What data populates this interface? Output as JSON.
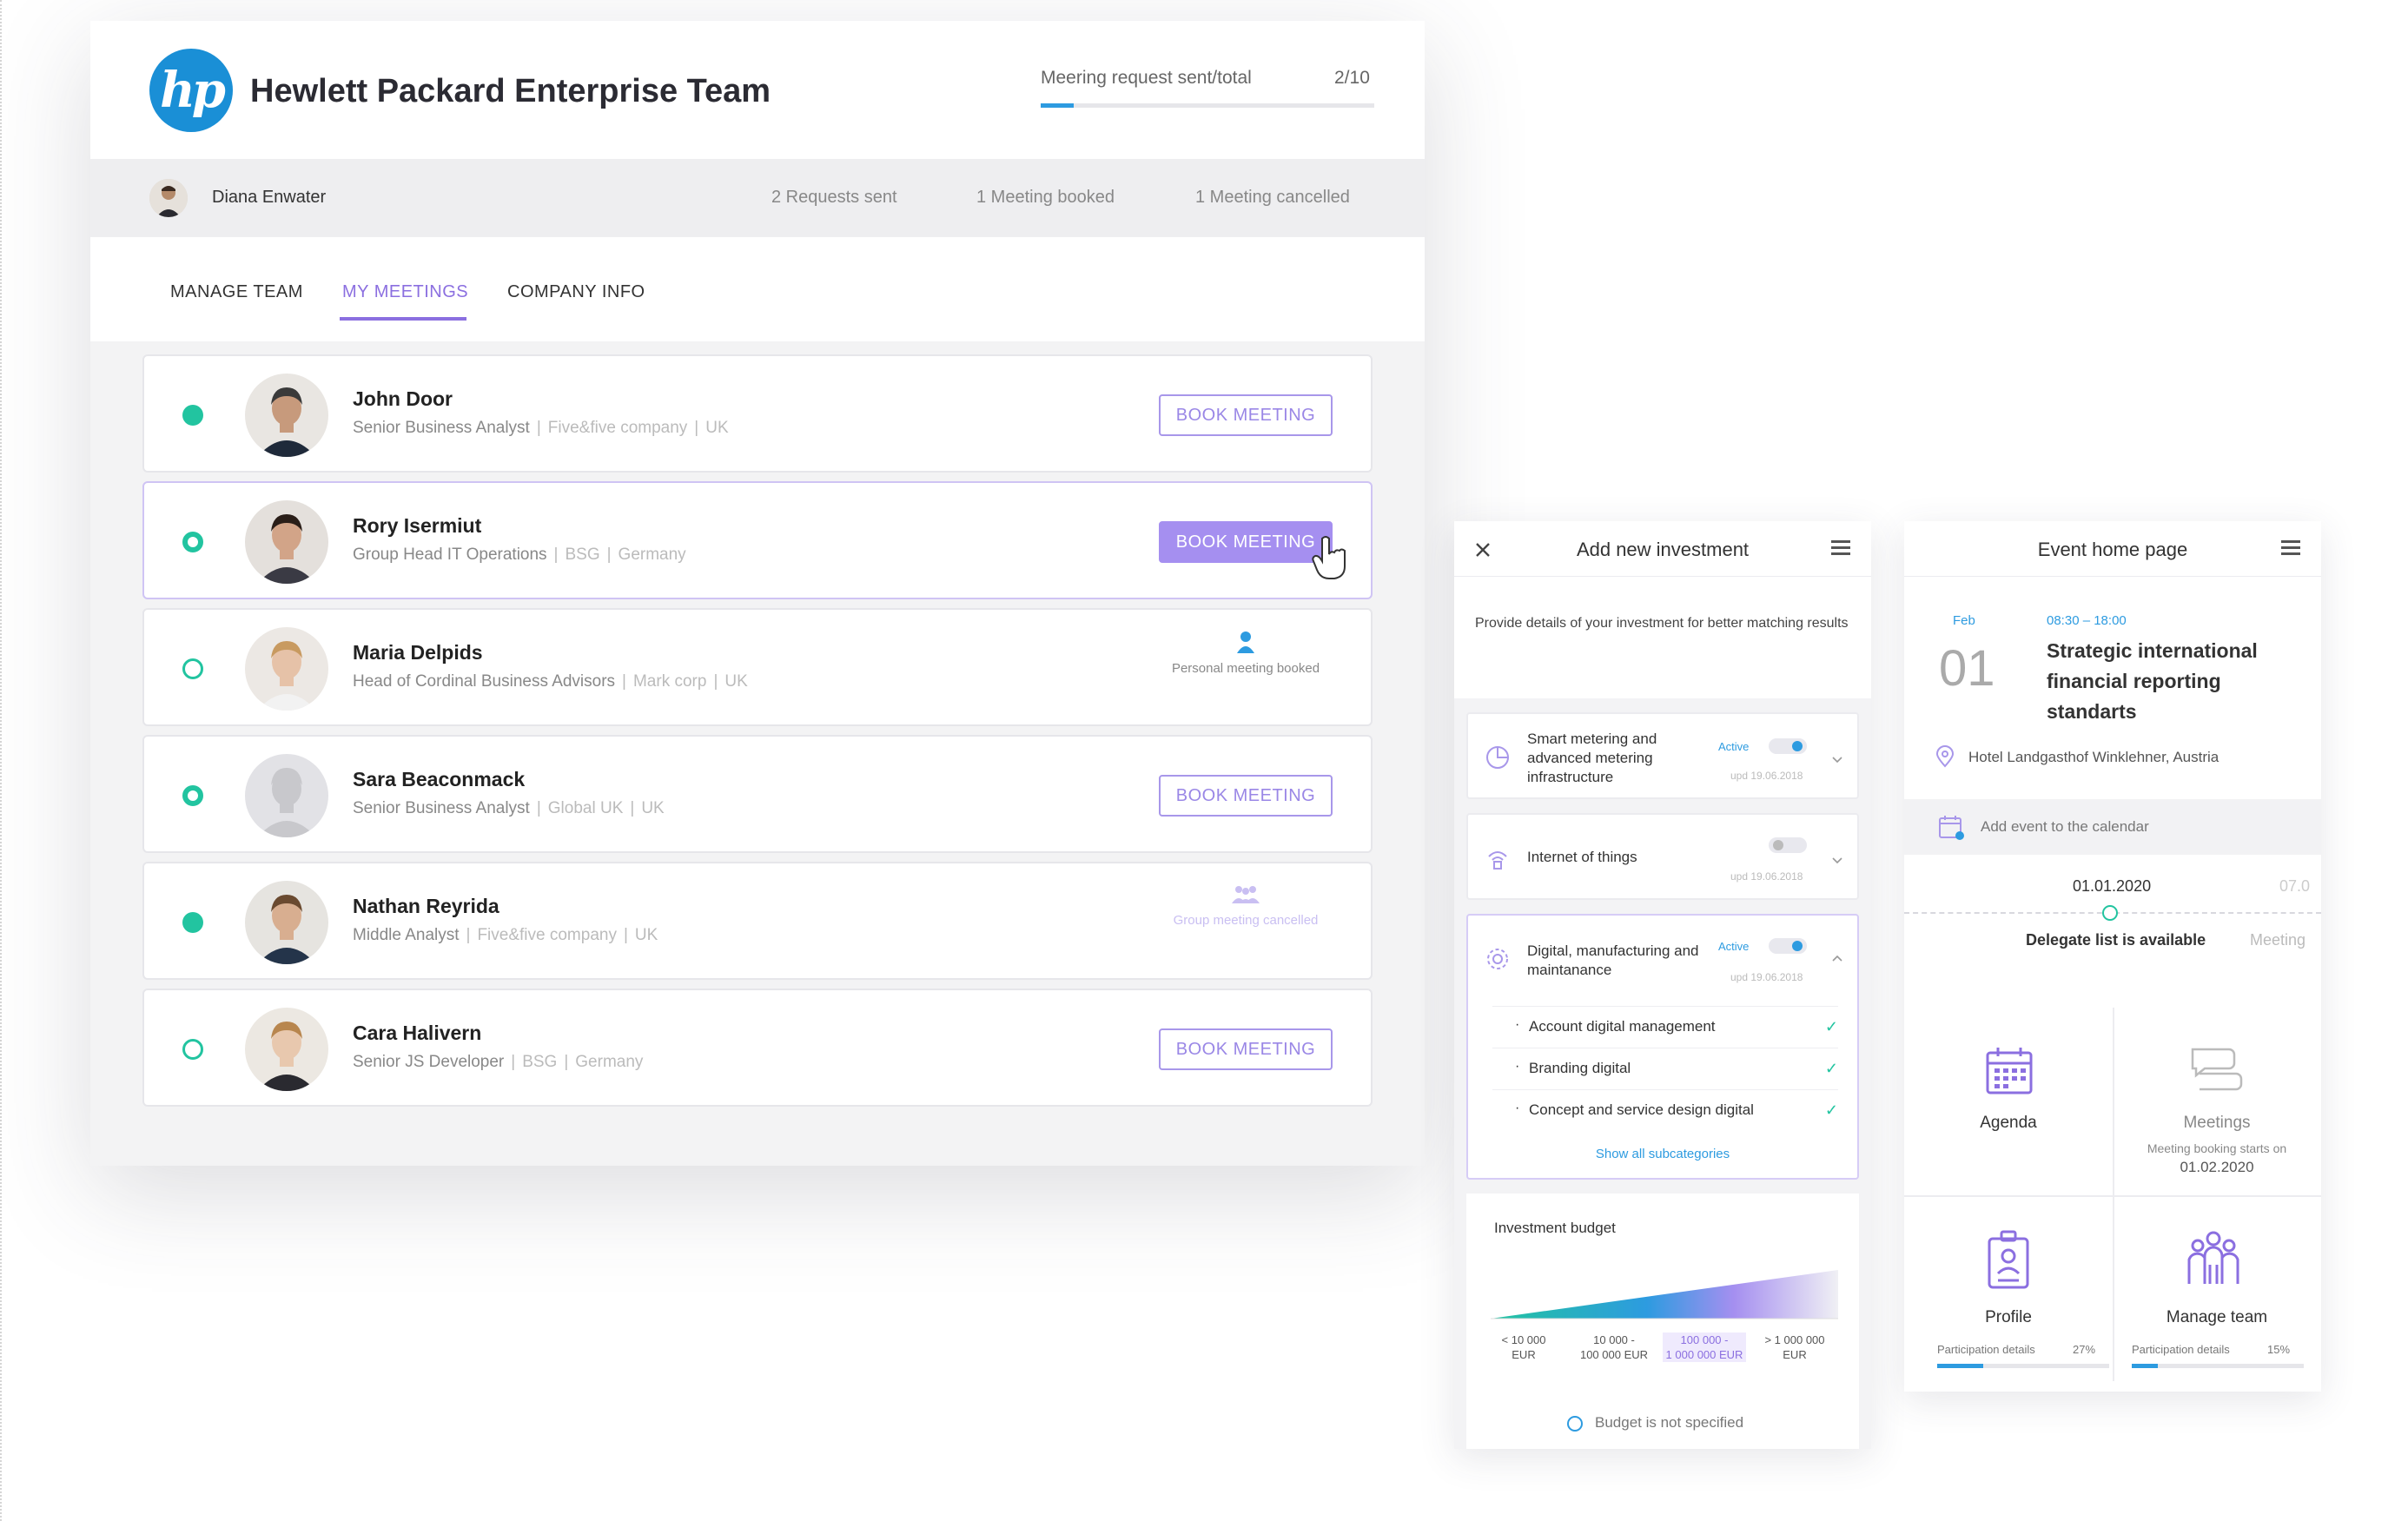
{
  "header": {
    "logo_text": "hp",
    "team_title": "Hewlett Packard Enterprise Team",
    "meeting_request_label": "Meering request sent/total",
    "meeting_request_count": "2/10",
    "meeting_request_progress": 0.2
  },
  "user_bar": {
    "name": "Diana Enwater",
    "requests_sent": "2 Requests sent",
    "meetings_booked": "1 Meeting booked",
    "meetings_cancelled": "1 Meeting cancelled"
  },
  "tabs": [
    {
      "label": "MANAGE TEAM",
      "active": false
    },
    {
      "label": "MY MEETINGS",
      "active": true
    },
    {
      "label": "COMPANY INFO",
      "active": false
    }
  ],
  "people": [
    {
      "name": "John Door",
      "role": "Senior Business Analyst",
      "company": "Five&five company",
      "country": "UK",
      "status": "full",
      "action": "BOOK MEETING"
    },
    {
      "name": "Rory Isermiut",
      "role": "Group Head IT Operations",
      "company": "BSG",
      "country": "Germany",
      "status": "ring-thick",
      "action": "BOOK MEETING"
    },
    {
      "name": "Maria Delpids",
      "role": "Head of Cordinal Business Advisors",
      "company": "Mark corp",
      "country": "UK",
      "status": "ring",
      "action_status": "Personal meeting booked"
    },
    {
      "name": "Sara Beaconmack",
      "role": "Senior Business Analyst",
      "company": "Global UK",
      "country": "UK",
      "status": "ring-thick",
      "action": "BOOK MEETING"
    },
    {
      "name": "Nathan Reyrida",
      "role": "Middle Analyst",
      "company": "Five&five company",
      "country": "UK",
      "status": "full",
      "action_status": "Group meeting cancelled"
    },
    {
      "name": "Cara Halivern",
      "role": "Senior JS Developer",
      "company": "BSG",
      "country": "Germany",
      "status": "ring",
      "action": "BOOK MEETING"
    }
  ],
  "investment": {
    "title": "Add new investment",
    "description": "Provide details of your investment for better matching results",
    "categories": [
      {
        "name": "Smart metering and advanced metering infrastructure",
        "toggle_label": "Active",
        "updated": "upd 19.06.2018",
        "icon": "pie-chart-icon"
      },
      {
        "name": "Internet of things",
        "toggle_label": "",
        "updated": "upd 19.06.2018",
        "icon": "wifi-icon"
      },
      {
        "name": "Digital, manufacturing and maintanance",
        "toggle_label": "Active",
        "updated": "upd 19.06.2018",
        "icon": "gear-icon"
      }
    ],
    "subcategories": [
      "Account digital management",
      "Branding digital",
      "Concept and service design digital"
    ],
    "show_all": "Show all subcategories",
    "budget": {
      "title": "Investment budget",
      "ranges": [
        {
          "label": "< 10 000",
          "unit": "EUR"
        },
        {
          "label": "10 000 -",
          "unit": "100 000 EUR"
        },
        {
          "label": "100 000 -",
          "unit": "1 000 000 EUR"
        },
        {
          "label": "> 1 000 000",
          "unit": "EUR"
        }
      ],
      "not_specified": "Budget is not specified"
    }
  },
  "event": {
    "title": "Event home page",
    "month": "Feb",
    "day": "01",
    "time": "08:30 – 18:00",
    "name": "Strategic international financial reporting standarts",
    "location": "Hotel Landgasthof Winklehner, Austria",
    "calendar_label": "Add event to the calendar",
    "timeline_date": "01.01.2020",
    "timeline_date_next": "07.0",
    "timeline_label": "Delegate list is available",
    "timeline_label_next": "Meeting",
    "tiles": {
      "agenda": "Agenda",
      "meetings": "Meetings",
      "meetings_note": "Meeting booking starts on",
      "meetings_date": "01.02.2020",
      "profile": "Profile",
      "manage_team": "Manage team",
      "participation_label": "Participation details",
      "profile_pct": "27%",
      "profile_fraction": 0.27,
      "team_pct": "15%",
      "team_fraction": 0.15
    }
  }
}
